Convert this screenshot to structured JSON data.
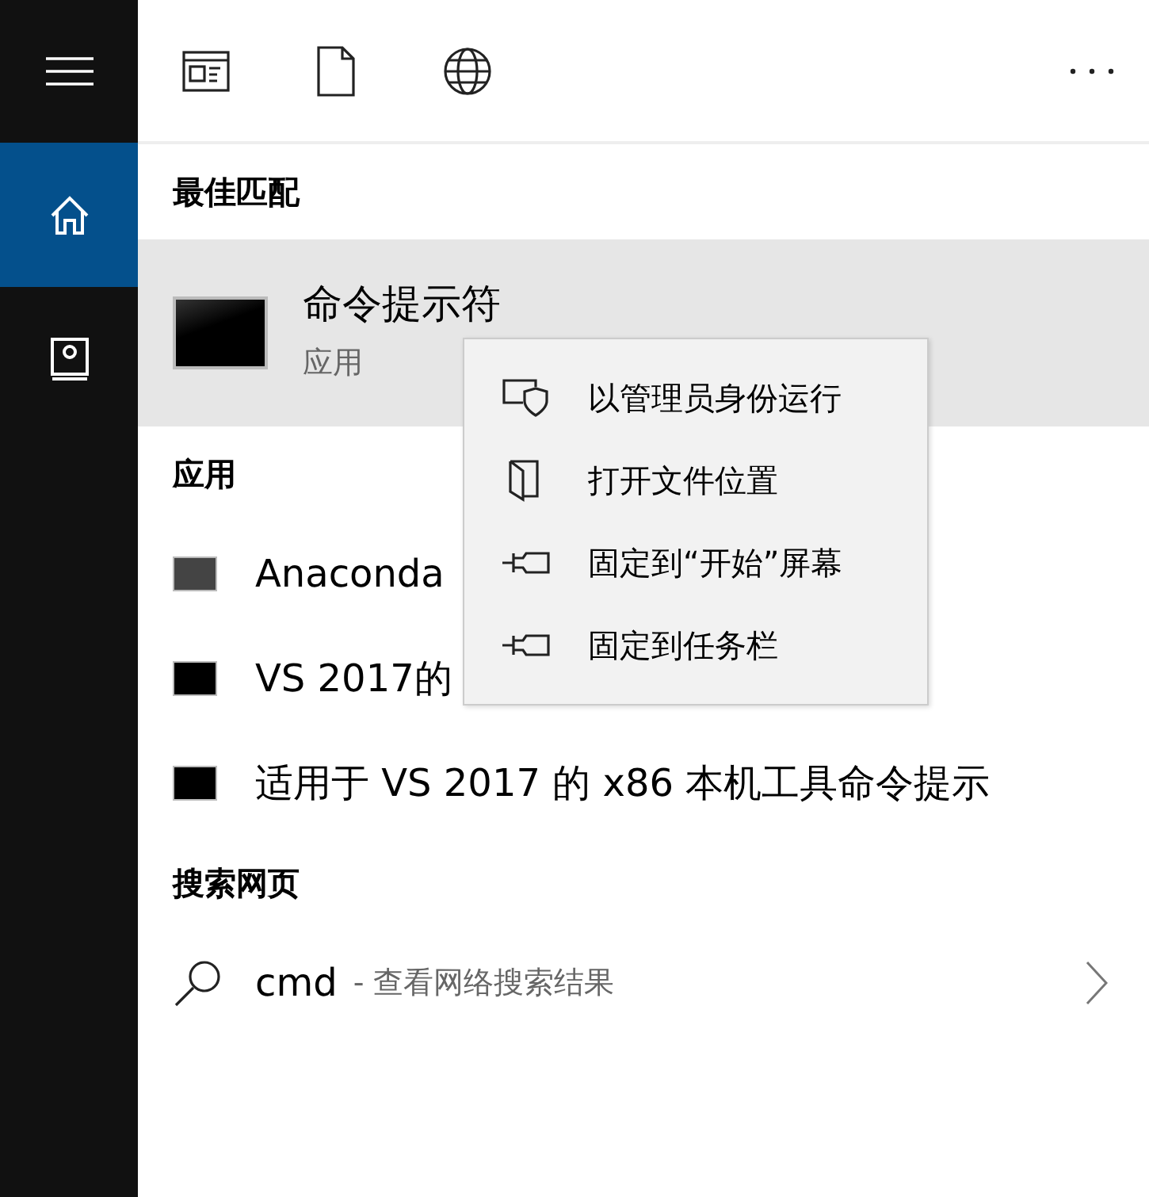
{
  "sidebar": {
    "items": [
      {
        "kind": "home",
        "selected": true
      },
      {
        "kind": "notebook",
        "selected": false
      }
    ]
  },
  "best_match": {
    "heading": "最佳匹配",
    "item": {
      "title": "命令提示符",
      "subtitle": "应用",
      "selected": true
    }
  },
  "apps": {
    "heading": "应用",
    "items": [
      {
        "title": "Anaconda",
        "kind": "anaconda"
      },
      {
        "title": "VS 2017的",
        "kind": "console"
      },
      {
        "title": "适用于 VS 2017 的 x86 本机工具命令提示",
        "kind": "console"
      }
    ]
  },
  "web": {
    "heading": "搜索网页",
    "item": {
      "query": "cmd",
      "hint": "- 查看网络搜索结果"
    }
  },
  "context_menu": {
    "items": [
      {
        "label": "以管理员身份运行",
        "kind": "shield"
      },
      {
        "label": "打开文件位置",
        "kind": "folder"
      },
      {
        "label": "固定到“开始”屏幕",
        "kind": "pin"
      },
      {
        "label": "固定到任务栏",
        "kind": "pin"
      }
    ]
  }
}
